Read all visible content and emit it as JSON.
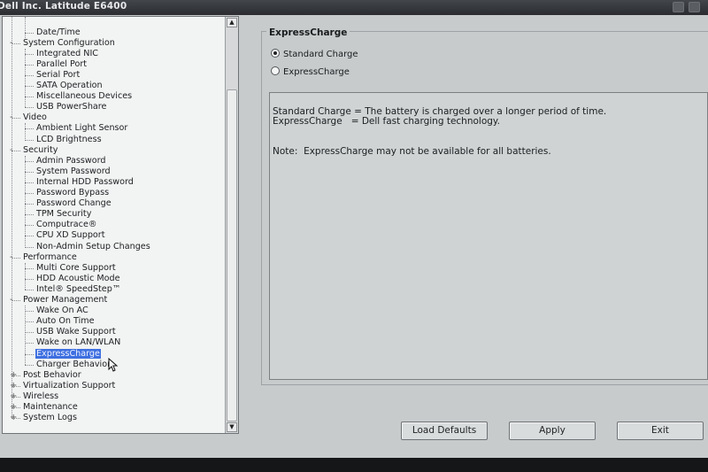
{
  "window": {
    "title": "Dell Inc. Latitude E6400"
  },
  "tree": {
    "items": [
      {
        "label": "Date/Time",
        "level": 1
      },
      {
        "label": "System Configuration",
        "level": 0,
        "expander": "-"
      },
      {
        "label": "Integrated NIC",
        "level": 1
      },
      {
        "label": "Parallel Port",
        "level": 1
      },
      {
        "label": "Serial Port",
        "level": 1
      },
      {
        "label": "SATA Operation",
        "level": 1
      },
      {
        "label": "Miscellaneous Devices",
        "level": 1
      },
      {
        "label": "USB PowerShare",
        "level": 1
      },
      {
        "label": "Video",
        "level": 0,
        "expander": "-"
      },
      {
        "label": "Ambient Light Sensor",
        "level": 1
      },
      {
        "label": "LCD Brightness",
        "level": 1
      },
      {
        "label": "Security",
        "level": 0,
        "expander": "-"
      },
      {
        "label": "Admin Password",
        "level": 1
      },
      {
        "label": "System Password",
        "level": 1
      },
      {
        "label": "Internal HDD Password",
        "level": 1
      },
      {
        "label": "Password Bypass",
        "level": 1
      },
      {
        "label": "Password Change",
        "level": 1
      },
      {
        "label": "TPM Security",
        "level": 1
      },
      {
        "label": "Computrace®",
        "level": 1
      },
      {
        "label": "CPU XD Support",
        "level": 1
      },
      {
        "label": "Non-Admin Setup Changes",
        "level": 1
      },
      {
        "label": "Performance",
        "level": 0,
        "expander": "-"
      },
      {
        "label": "Multi Core Support",
        "level": 1
      },
      {
        "label": "HDD Acoustic Mode",
        "level": 1
      },
      {
        "label": "Intel® SpeedStep™",
        "level": 1
      },
      {
        "label": "Power Management",
        "level": 0,
        "expander": "-"
      },
      {
        "label": "Wake On AC",
        "level": 1
      },
      {
        "label": "Auto On Time",
        "level": 1
      },
      {
        "label": "USB Wake Support",
        "level": 1
      },
      {
        "label": "Wake on LAN/WLAN",
        "level": 1
      },
      {
        "label": "ExpressCharge",
        "level": 1,
        "selected": true
      },
      {
        "label": "Charger Behavior",
        "level": 1
      },
      {
        "label": "Post Behavior",
        "level": 0,
        "expander": "+"
      },
      {
        "label": "Virtualization Support",
        "level": 0,
        "expander": "+"
      },
      {
        "label": "Wireless",
        "level": 0,
        "expander": "+"
      },
      {
        "label": "Maintenance",
        "level": 0,
        "expander": "+"
      },
      {
        "label": "System Logs",
        "level": 0,
        "expander": "+"
      }
    ],
    "scroll_up_icon": "triangle-up-icon",
    "scroll_down_icon": "triangle-down-icon"
  },
  "panel": {
    "title": "ExpressCharge",
    "options": [
      {
        "label": "Standard Charge",
        "selected": true
      },
      {
        "label": "ExpressCharge",
        "selected": false
      }
    ],
    "help": {
      "line1": "Standard Charge = The battery is charged over a longer period of time.",
      "line2": "ExpressCharge   = Dell fast charging technology.",
      "line3": "Note:  ExpressCharge may not be available for all batteries."
    }
  },
  "buttons": {
    "load_defaults": "Load Defaults",
    "apply": "Apply",
    "exit": "Exit"
  },
  "cursor_icon": "mouse-pointer-icon"
}
